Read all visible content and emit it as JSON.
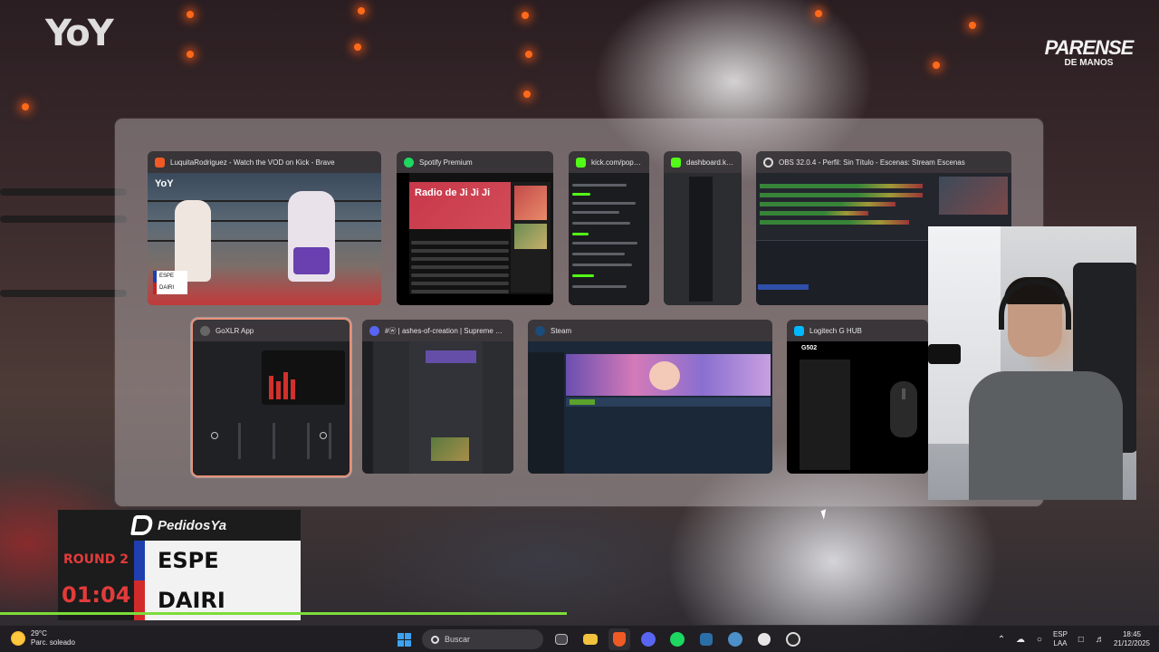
{
  "overlay": {
    "channel_logo": "YoY",
    "event_logo_line1": "PARENSE",
    "event_logo_line2": "DE MANOS"
  },
  "switcher": {
    "windows": [
      {
        "title": "LuquitaRodriguez - Watch the VOD on Kick - Brave",
        "icon": "brave-icon",
        "selected": false
      },
      {
        "title": "Spotify Premium",
        "icon": "spotify-icon",
        "selected": false,
        "thumb_heading": "Radio de Ji Ji Ji"
      },
      {
        "title": "kick.com/popo...",
        "icon": "kick-icon",
        "selected": false
      },
      {
        "title": "dashboard.kick...",
        "icon": "kick-icon",
        "selected": false
      },
      {
        "title": "OBS 32.0.4 - Perfil: Sin Título - Escenas: Stream Escenas",
        "icon": "obs-icon",
        "selected": false
      },
      {
        "title": "GoXLR App",
        "icon": "goxlr-icon",
        "selected": true
      },
      {
        "title": "#ⓦ | ashes-of-creation | Supreme Nat...",
        "icon": "discord-icon",
        "selected": false
      },
      {
        "title": "Steam",
        "icon": "steam-icon",
        "selected": false
      },
      {
        "title": "Logitech G HUB",
        "icon": "logitech-icon",
        "selected": false,
        "thumb_heading": "G502"
      }
    ]
  },
  "scoreboard": {
    "sponsor": "PedidosYa",
    "round": "ROUND 2",
    "clock": "01:04",
    "fighter_blue": "ESPE",
    "fighter_red": "DAIRI",
    "colors": {
      "blue": "#1f3faf",
      "red": "#d22a2a",
      "clock": "#e23b3b"
    }
  },
  "taskbar": {
    "weather_temp": "29°C",
    "weather_desc": "Parc. soleado",
    "search_placeholder": "Buscar",
    "pinned": [
      "windows-start-icon",
      "search",
      "task-view-icon",
      "file-explorer-icon",
      "brave-icon",
      "discord-icon",
      "spotify-icon",
      "xsplit-icon",
      "steam-icon",
      "logitech-ghub-icon",
      "obs-icon"
    ],
    "lang_line1": "ESP",
    "lang_line2": "LAA",
    "time": "18:45",
    "date": "21/12/2025"
  }
}
